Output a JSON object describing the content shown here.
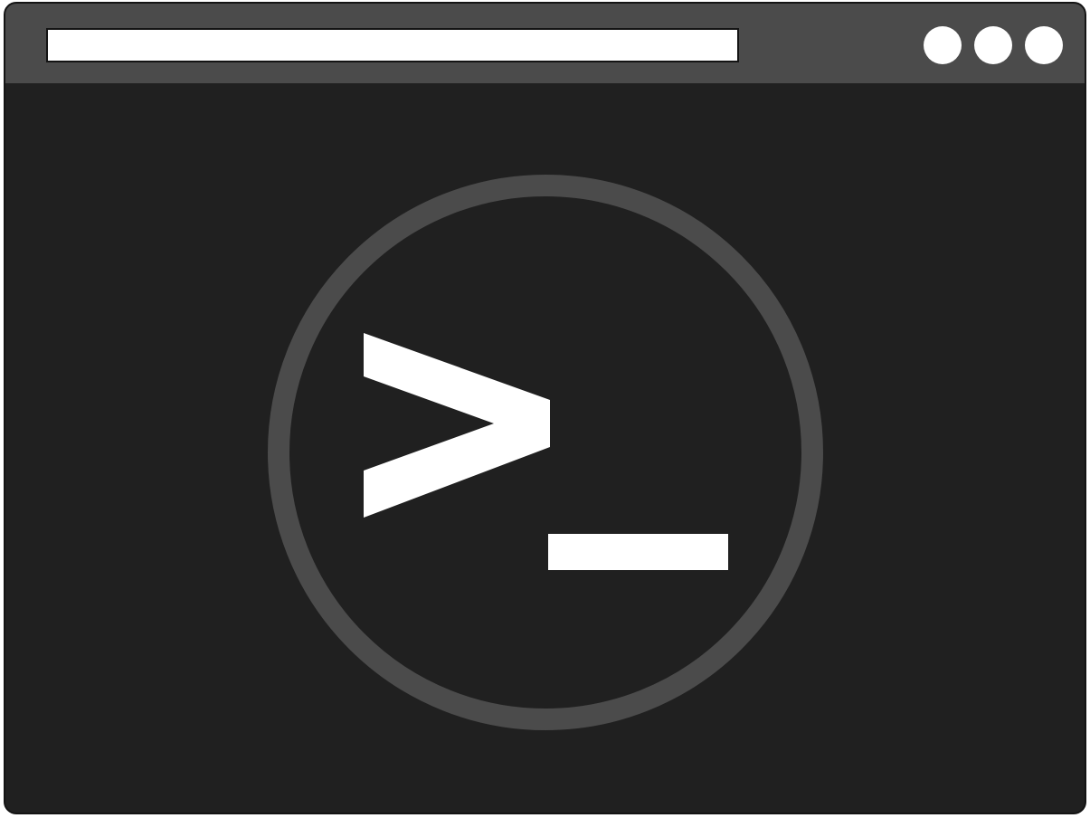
{
  "window": {
    "address_bar_value": "",
    "controls": [
      {
        "icon": "circle-icon"
      },
      {
        "icon": "circle-icon"
      },
      {
        "icon": "circle-icon"
      }
    ]
  },
  "content": {
    "emblem": {
      "icon": "terminal-prompt-icon",
      "ring_color": "#4b4b4b",
      "glyph_color": "#ffffff"
    }
  },
  "colors": {
    "window_bg": "#202020",
    "titlebar_bg": "#4b4b4b",
    "address_bar_bg": "#ffffff"
  }
}
